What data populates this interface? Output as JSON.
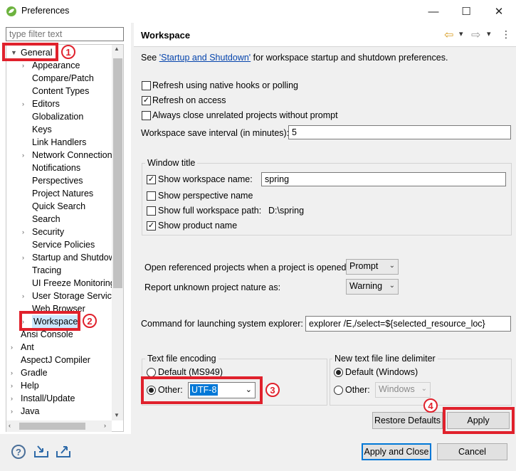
{
  "window": {
    "title": "Preferences",
    "minimize": "—",
    "maximize": "☐",
    "close": "✕"
  },
  "filter": {
    "placeholder": "type filter text"
  },
  "tree": [
    {
      "label": "General",
      "arrow": "▼",
      "expanded": true
    },
    {
      "label": "Appearance",
      "arrow": "›"
    },
    {
      "label": "Compare/Patch"
    },
    {
      "label": "Content Types"
    },
    {
      "label": "Editors",
      "arrow": "›"
    },
    {
      "label": "Globalization"
    },
    {
      "label": "Keys"
    },
    {
      "label": "Link Handlers"
    },
    {
      "label": "Network Connection",
      "arrow": "›"
    },
    {
      "label": "Notifications"
    },
    {
      "label": "Perspectives"
    },
    {
      "label": "Project Natures"
    },
    {
      "label": "Quick Search"
    },
    {
      "label": "Search"
    },
    {
      "label": "Security",
      "arrow": "›"
    },
    {
      "label": "Service Policies"
    },
    {
      "label": "Startup and Shutdow",
      "arrow": "›"
    },
    {
      "label": "Tracing"
    },
    {
      "label": "UI Freeze Monitoring"
    },
    {
      "label": "User Storage Service",
      "arrow": "›"
    },
    {
      "label": "Web Browser"
    },
    {
      "label": "Workspace",
      "arrow": "›",
      "selected": true
    },
    {
      "label": "Ansi Console"
    },
    {
      "label": "Ant",
      "arrow": "›"
    },
    {
      "label": "AspectJ Compiler"
    },
    {
      "label": "Gradle",
      "arrow": "›"
    },
    {
      "label": "Help",
      "arrow": "›"
    },
    {
      "label": "Install/Update",
      "arrow": "›"
    },
    {
      "label": "Java",
      "arrow": "›"
    }
  ],
  "page": {
    "title": "Workspace",
    "nav_back": "⇦",
    "nav_forward": "⇨",
    "menu": "▾",
    "see_prefix": "See ",
    "see_link": "'Startup and Shutdown'",
    "see_suffix": " for workspace startup and shutdown preferences.",
    "refresh_native": {
      "label": "Refresh using native hooks or polling",
      "checked": false
    },
    "refresh_access": {
      "label": "Refresh on access",
      "checked": true
    },
    "always_close": {
      "label": "Always close unrelated projects without prompt",
      "checked": false
    },
    "save_interval_label": "Workspace save interval (in minutes):",
    "save_interval_value": "5",
    "window_title": {
      "group": "Window title",
      "show_name": {
        "label": "Show workspace name:",
        "checked": true,
        "value": "spring"
      },
      "show_perspective": {
        "label": "Show perspective name",
        "checked": false
      },
      "show_path": {
        "label": "Show full workspace path:",
        "checked": false,
        "value": "D:\\spring"
      },
      "show_product": {
        "label": "Show product name",
        "checked": true
      }
    },
    "open_referenced": {
      "label": "Open referenced projects when a project is opened:",
      "value": "Prompt"
    },
    "report_unknown": {
      "label": "Report unknown project nature as:",
      "value": "Warning"
    },
    "explorer": {
      "label": "Command for launching system explorer:",
      "value": "explorer /E,/select=${selected_resource_loc}"
    },
    "encoding": {
      "group": "Text file encoding",
      "default_label": "Default (MS949)",
      "other_label": "Other:",
      "other_value": "UTF-8"
    },
    "delimiter": {
      "group": "New text file line delimiter",
      "default_label": "Default (Windows)",
      "other_label": "Other:",
      "other_value": "Windows"
    },
    "restore_defaults": "Restore Defaults",
    "apply": "Apply"
  },
  "footer": {
    "apply_close": "Apply and Close",
    "cancel": "Cancel",
    "help": "?"
  },
  "annotations": [
    "1",
    "2",
    "3",
    "4"
  ],
  "colors": {
    "highlight_red": "#e0212c",
    "link": "#0645ad",
    "selection": "#0078d7"
  }
}
